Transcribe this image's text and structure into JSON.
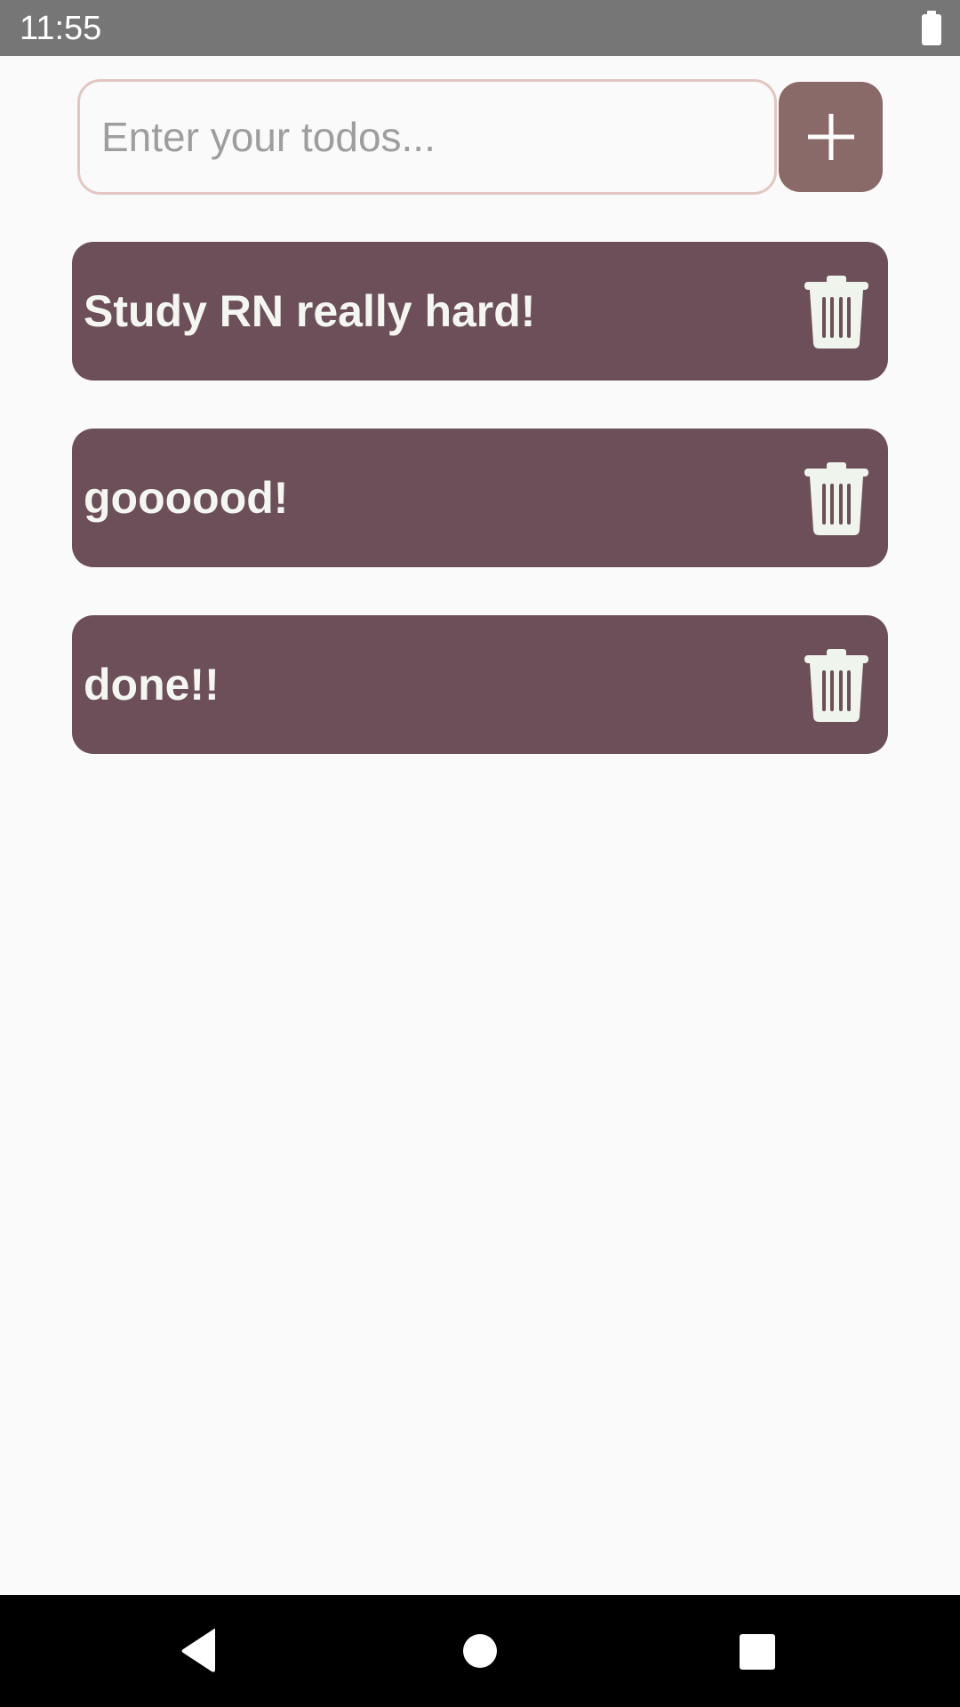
{
  "status_bar": {
    "time": "11:55",
    "battery_icon": "battery-full-icon"
  },
  "input": {
    "placeholder": "Enter your todos...",
    "value": ""
  },
  "add_button": {
    "icon": "plus-icon",
    "color": "#8A6A68"
  },
  "todos": [
    {
      "text": "Study RN really hard!",
      "delete_icon": "trash-icon"
    },
    {
      "text": "goooood!",
      "delete_icon": "trash-icon"
    },
    {
      "text": "done!!",
      "delete_icon": "trash-icon"
    }
  ],
  "colors": {
    "background": "#FAFAFA",
    "todo_item": "#6C4F59",
    "todo_text": "#F4F7F1",
    "input_border": "#E2C6C2",
    "status_bar": "#767676",
    "nav_bar": "#000000"
  },
  "nav_bar": {
    "back_icon": "back-triangle-icon",
    "home_icon": "home-circle-icon",
    "recent_icon": "recent-apps-square-icon"
  }
}
